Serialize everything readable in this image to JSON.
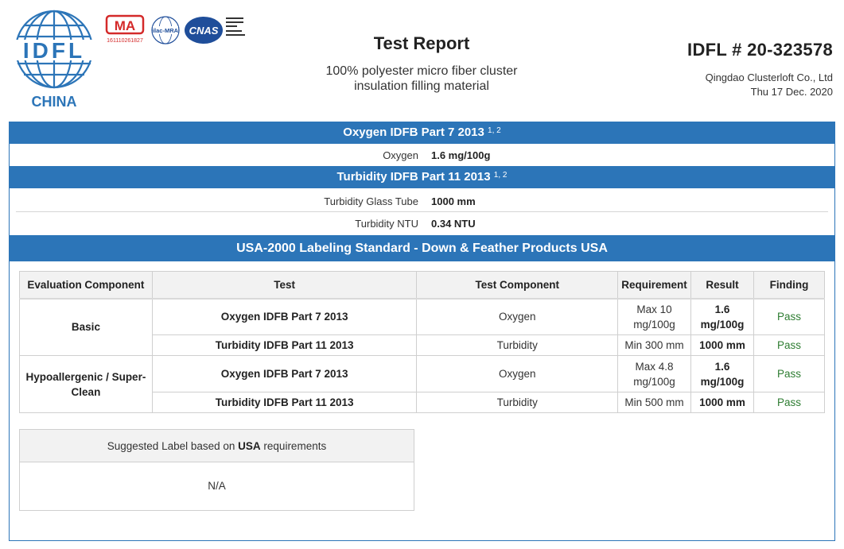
{
  "header": {
    "logo_text": "IDFL",
    "logo_country": "CHINA",
    "cert_ma_text": "MA",
    "cert_ma_number": "161110261827",
    "cert_ilac_text": "ilac-MRA",
    "cert_cnas_text": "CNAS",
    "title": "Test Report",
    "subtitle_line1": "100% polyester micro fiber cluster",
    "subtitle_line2": "insulation filling material",
    "idfl_number": "IDFL # 20-323578",
    "company": "Qingdao Clusterloft Co., Ltd",
    "date": "Thu 17 Dec. 2020"
  },
  "sections": {
    "oxygen": {
      "title": "Oxygen IDFB Part 7 2013",
      "footnote": "1, 2",
      "rows": [
        {
          "label": "Oxygen",
          "value": "1.6 mg/100g"
        }
      ]
    },
    "turbidity": {
      "title": "Turbidity IDFB Part 11 2013",
      "footnote": "1, 2",
      "rows": [
        {
          "label": "Turbidity Glass Tube",
          "value": "1000 mm"
        },
        {
          "label": "Turbidity NTU",
          "value": "0.34 NTU"
        }
      ]
    },
    "usa": {
      "title": "USA-2000 Labeling Standard - Down & Feather Products USA"
    }
  },
  "eval_table": {
    "headers": [
      "Evaluation Component",
      "Test",
      "Test Component",
      "Requirement",
      "Result",
      "Finding"
    ],
    "groups": [
      {
        "component": "Basic",
        "rows": [
          {
            "test": "Oxygen IDFB Part 7 2013",
            "test_component": "Oxygen",
            "requirement": "Max 10 mg/100g",
            "result": "1.6 mg/100g",
            "finding": "Pass"
          },
          {
            "test": "Turbidity IDFB Part 11 2013",
            "test_component": "Turbidity",
            "requirement": "Min 300 mm",
            "result": "1000 mm",
            "finding": "Pass"
          }
        ]
      },
      {
        "component": "Hypoallergenic / Super-Clean",
        "rows": [
          {
            "test": "Oxygen IDFB Part 7 2013",
            "test_component": "Oxygen",
            "requirement": "Max 4.8 mg/100g",
            "result": "1.6 mg/100g",
            "finding": "Pass"
          },
          {
            "test": "Turbidity IDFB Part 11 2013",
            "test_component": "Turbidity",
            "requirement": "Min 500 mm",
            "result": "1000 mm",
            "finding": "Pass"
          }
        ]
      }
    ]
  },
  "suggested_label": {
    "prefix": "Suggested Label based on ",
    "country": "USA",
    "suffix": " requirements",
    "value": "N/A"
  },
  "colors": {
    "accent": "#2c75b8",
    "pass": "#2e7d32",
    "header_bg": "#f2f2f2",
    "ma_red": "#d42a2a",
    "cnas_blue": "#1f4e9a"
  }
}
